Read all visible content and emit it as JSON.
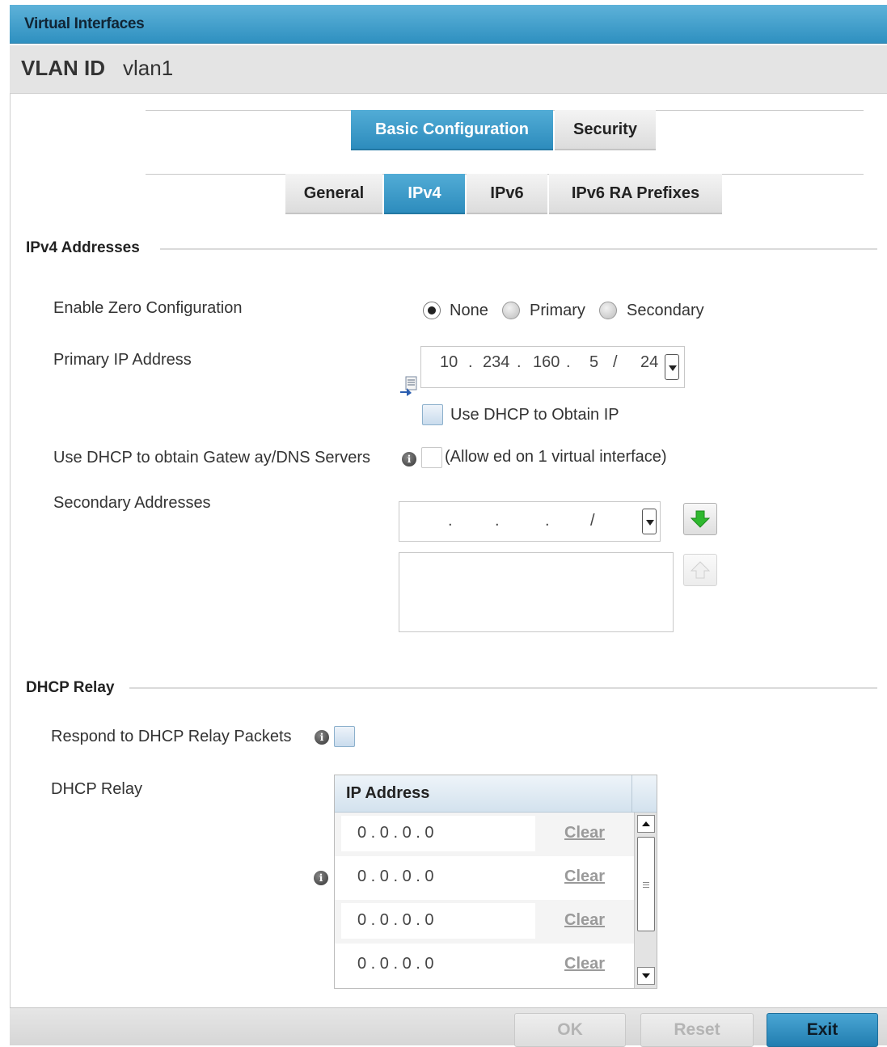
{
  "window": {
    "title": "Virtual Interfaces"
  },
  "vlan": {
    "label": "VLAN ID",
    "value": "vlan1"
  },
  "tabs_top": [
    {
      "label": "Basic Configuration",
      "active": true
    },
    {
      "label": "Security",
      "active": false
    }
  ],
  "tabs_sub": [
    {
      "label": "General",
      "active": false
    },
    {
      "label": "IPv4",
      "active": true
    },
    {
      "label": "IPv6",
      "active": false
    },
    {
      "label": "IPv6 RA Prefixes",
      "active": false
    }
  ],
  "ipv4": {
    "section_title": "IPv4 Addresses",
    "zero_config": {
      "label": "Enable Zero Configuration",
      "options": [
        "None",
        "Primary",
        "Secondary"
      ],
      "selected": "None"
    },
    "primary_ip": {
      "label": "Primary IP Address",
      "octets": [
        "10",
        "234",
        "160",
        "5"
      ],
      "mask": "24",
      "dhcp_label": "Use DHCP to Obtain IP",
      "dhcp_checked": false
    },
    "dhcp_gateway": {
      "label": "Use DHCP to obtain Gatew ay/DNS Servers",
      "note": "(Allow ed on 1 virtual interface)",
      "checked": false
    },
    "secondary": {
      "label": "Secondary Addresses",
      "sep": ".",
      "slash": "/"
    }
  },
  "relay": {
    "section_title": "DHCP Relay",
    "respond_label": "Respond to DHCP Relay Packets",
    "respond_checked": false,
    "relay_label": "DHCP Relay",
    "column_header": "IP Address",
    "rows": [
      {
        "ip": "0 . 0 . 0 . 0",
        "action": "Clear"
      },
      {
        "ip": "0 . 0 . 0 . 0",
        "action": "Clear"
      },
      {
        "ip": "0 . 0 . 0 . 0",
        "action": "Clear"
      },
      {
        "ip": "0 . 0 . 0 . 0",
        "action": "Clear"
      }
    ]
  },
  "footer": {
    "ok": "OK",
    "reset": "Reset",
    "exit": "Exit"
  },
  "colors": {
    "accent": "#2f90c0",
    "header_bg": "#e4e4e4",
    "add_arrow": "#2eb82e"
  }
}
